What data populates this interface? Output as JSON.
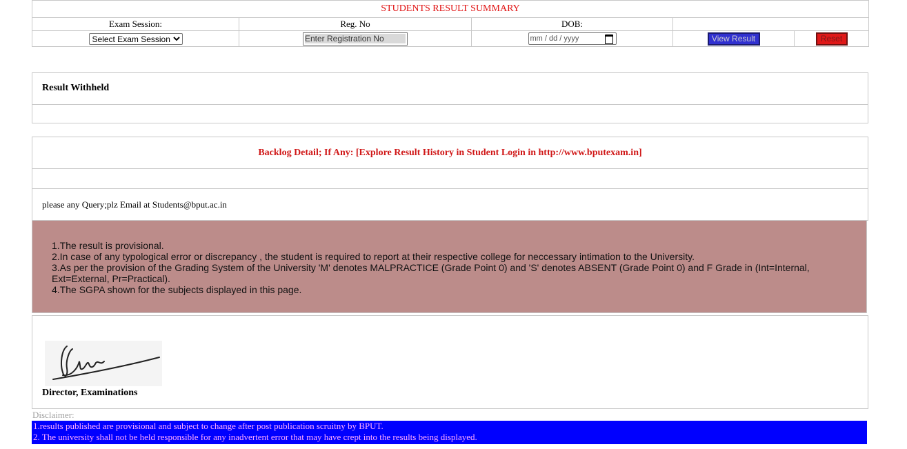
{
  "header": {
    "title": "STUDENTS RESULT SUMMARY",
    "exam_session_label": "Exam Session:",
    "reg_no_label": "Reg. No",
    "dob_label": "DOB:"
  },
  "form": {
    "session_select": "Select Exam Session",
    "reg_placeholder": "Enter Registration No",
    "dob_placeholder": "mm / dd / yyyy",
    "view_button": "View Result",
    "reset_button": "Reset"
  },
  "sections": {
    "withheld": "Result Withheld",
    "backlog": "Backlog Detail; If Any: [Explore Result History in Student Login in http://www.bputexam.in]",
    "query": "please any Query;plz Email at Students@bput.ac.in"
  },
  "notes": [
    "1.The result is provisional.",
    "2.In case of any typological error or discrepancy , the student is required to report at their respective college for neccessary intimation to the University.",
    "3.As per the provision of the Grading System of the University 'M' denotes MALPRACTICE (Grade Point 0) and 'S' denotes ABSENT (Grade Point 0) and F Grade in (Int=Internal, Ext=External, Pr=Practical).",
    "4.The SGPA shown for the subjects displayed in this page."
  ],
  "signature": {
    "title": "Director, Examinations"
  },
  "disclaimer": {
    "label": "Disclaimer:",
    "lines": [
      "1.results published are provisional and subject to change after post publication scruitny by BPUT.",
      "2. The university shall not be held responsible for any inadvertent error that may have crept into the results being displayed."
    ]
  },
  "colors": {
    "title_red": "#e01010",
    "notes_bg": "#bc8c8a",
    "disclaimer_bg": "#0000ff",
    "view_button_bg": "#3030d0",
    "reset_button_bg": "#e01818"
  }
}
